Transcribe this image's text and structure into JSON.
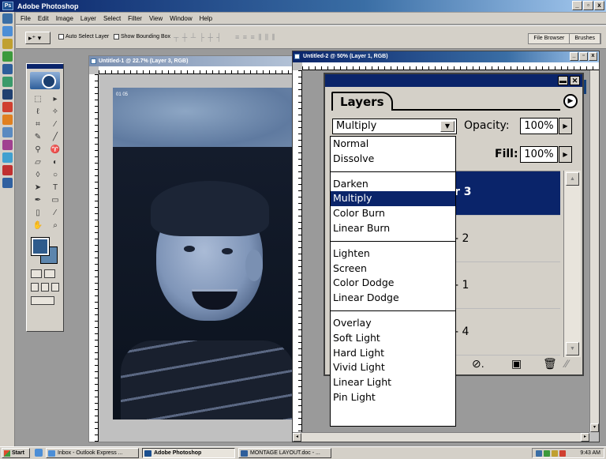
{
  "app": {
    "title": "Adobe Photoshop"
  },
  "menu": [
    "File",
    "Edit",
    "Image",
    "Layer",
    "Select",
    "Filter",
    "View",
    "Window",
    "Help"
  ],
  "options_bar": {
    "auto_select": "Auto Select Layer",
    "bounding_box": "Show Bounding Box",
    "palette_tabs": [
      "File Browser",
      "Brushes"
    ]
  },
  "doc1": {
    "title": "Untitled-1 @ 22.7% (Layer 3, RGB)",
    "layer_label": "01 05"
  },
  "doc2": {
    "title": "Untitled-2 @ 50% (Layer 1, RGB)"
  },
  "layers_palette": {
    "tab_label": "Layers",
    "blend_mode": "Multiply",
    "opacity_label": "Opacity:",
    "opacity_value": "100%",
    "fill_label": "Fill:",
    "fill_value": "100%",
    "rows": [
      {
        "label": "r 3",
        "selected": true
      },
      {
        "label": "- 2",
        "selected": false
      },
      {
        "label": "- 1",
        "selected": false
      },
      {
        "label": "- 4",
        "selected": false
      }
    ]
  },
  "blend_modes": [
    [
      "Normal",
      "Dissolve"
    ],
    [
      "Darken",
      "Multiply",
      "Color Burn",
      "Linear Burn"
    ],
    [
      "Lighten",
      "Screen",
      "Color Dodge",
      "Linear Dodge"
    ],
    [
      "Overlay",
      "Soft Light",
      "Hard Light",
      "Vivid Light",
      "Linear Light",
      "Pin Light"
    ]
  ],
  "blend_selected": "Multiply",
  "taskbar": {
    "start": "Start",
    "buttons": [
      {
        "label": "Inbox - Outlook Express ...",
        "active": false
      },
      {
        "label": "Adobe Photoshop",
        "active": true
      },
      {
        "label": "MONTAGE LAYOUT.doc - ...",
        "active": false
      }
    ],
    "clock": "9:43 AM"
  },
  "colors": {
    "title_blue": "#0a246a",
    "foreground": "#2f5b8c",
    "background": "#5c85ad"
  }
}
